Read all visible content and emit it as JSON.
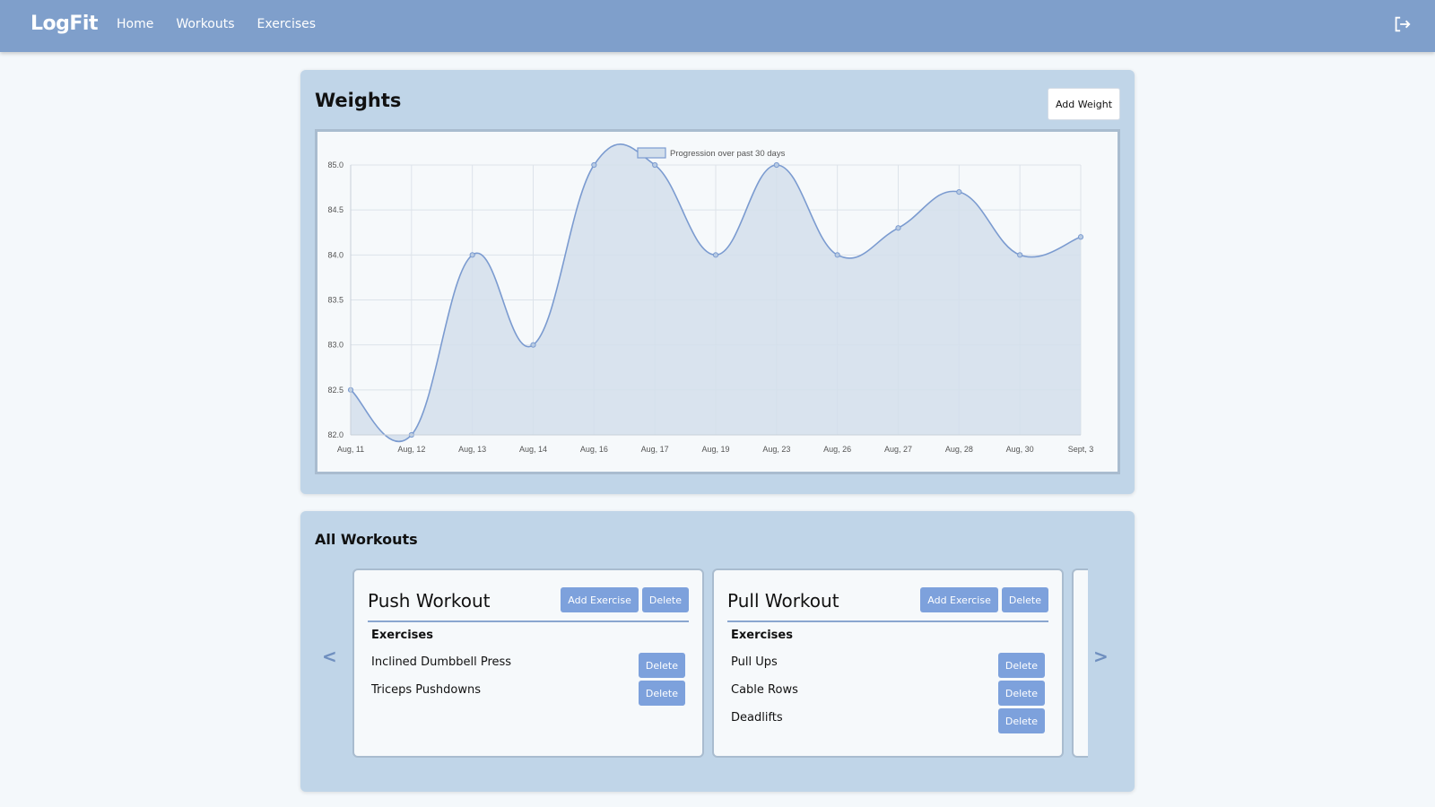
{
  "app": {
    "brand": "LogFit"
  },
  "nav": {
    "items": [
      "Home",
      "Workouts",
      "Exercises"
    ]
  },
  "icons": {
    "logout": "logout-icon",
    "prev": "chevron-left-icon",
    "next": "chevron-right-icon"
  },
  "colors": {
    "navbar": "#7f9fcb",
    "panel": "#c0d5e8",
    "accent": "#7da1dc",
    "line": "#7b9bd0",
    "fill": "#d3dfeb"
  },
  "weights": {
    "title": "Weights",
    "add_button": "Add Weight"
  },
  "chart_data": {
    "type": "area",
    "title": "",
    "legend": "Progression over past 30 days",
    "legend_position": "top-center",
    "grid": true,
    "x": [
      "Aug, 11",
      "Aug, 12",
      "Aug, 13",
      "Aug, 14",
      "Aug, 16",
      "Aug, 17",
      "Aug, 19",
      "Aug, 23",
      "Aug, 26",
      "Aug, 27",
      "Aug, 28",
      "Aug, 30",
      "Sept, 3"
    ],
    "series": [
      {
        "name": "Progression over past 30 days",
        "values": [
          82.5,
          82.0,
          84.0,
          83.0,
          85.0,
          85.0,
          84.0,
          85.0,
          84.0,
          84.3,
          84.7,
          84.0,
          84.2
        ]
      }
    ],
    "y_ticks": [
      "85.0",
      "84.5",
      "84.0",
      "83.5",
      "83.0",
      "82.5",
      "82.0"
    ],
    "ylim": [
      82.0,
      85.0
    ]
  },
  "workouts": {
    "title": "All Workouts",
    "prev": "<",
    "next": ">",
    "exercises_label": "Exercises",
    "add_exercise_label": "Add Exercise",
    "delete_label": "Delete",
    "cards": [
      {
        "name": "Push Workout",
        "exercises": [
          "Inclined Dumbbell Press",
          "Triceps Pushdowns"
        ]
      },
      {
        "name": "Pull Workout",
        "exercises": [
          "Pull Ups",
          "Cable Rows",
          "Deadlifts"
        ]
      }
    ]
  }
}
